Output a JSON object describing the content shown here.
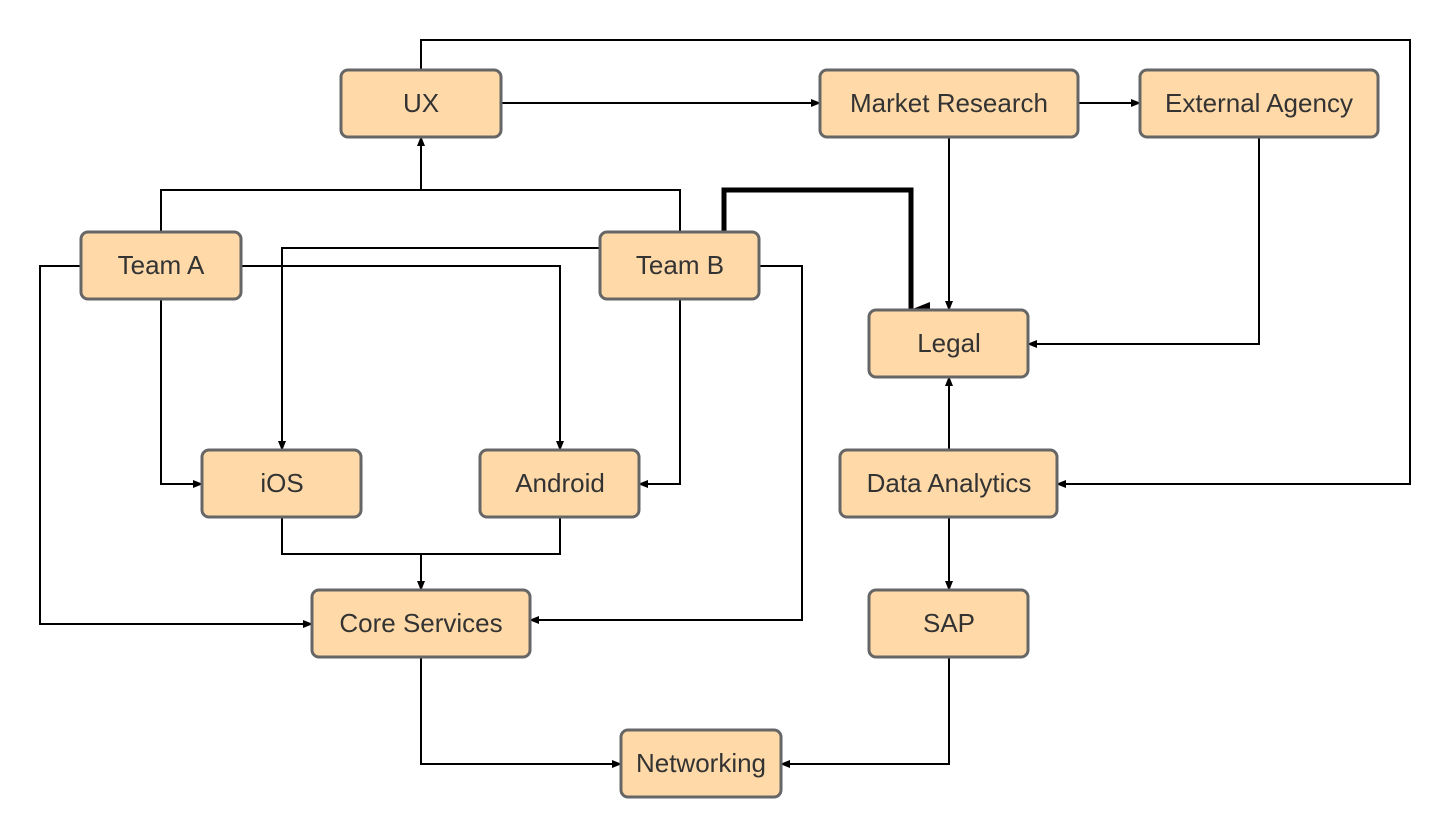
{
  "diagram": {
    "colors": {
      "node_fill": "#FFDAA8",
      "node_border": "#666666",
      "text": "#333333",
      "edge": "#000000"
    },
    "nodes": {
      "ux": "UX",
      "market_research": "Market Research",
      "external_agency": "External Agency",
      "team_a": "Team A",
      "team_b": "Team B",
      "legal": "Legal",
      "ios": "iOS",
      "android": "Android",
      "data_analytics": "Data Analytics",
      "core_services": "Core Services",
      "sap": "SAP",
      "networking": "Networking"
    },
    "edges": [
      {
        "from": "UX",
        "to": "Market Research"
      },
      {
        "from": "Market Research",
        "to": "External Agency"
      },
      {
        "from": "UX",
        "to": "Data Analytics"
      },
      {
        "from": "Team A",
        "to": "UX"
      },
      {
        "from": "Team B",
        "to": "UX"
      },
      {
        "from": "Team B",
        "to": "Legal",
        "emphasis": "thick"
      },
      {
        "from": "Market Research",
        "to": "Legal"
      },
      {
        "from": "External Agency",
        "to": "Legal"
      },
      {
        "from": "Team A",
        "to": "iOS"
      },
      {
        "from": "Team A",
        "to": "Android"
      },
      {
        "from": "Team B",
        "to": "iOS"
      },
      {
        "from": "Team B",
        "to": "Android"
      },
      {
        "from": "Team A",
        "to": "Core Services"
      },
      {
        "from": "Team B",
        "to": "Core Services"
      },
      {
        "from": "iOS",
        "to": "Core Services"
      },
      {
        "from": "Android",
        "to": "Core Services"
      },
      {
        "from": "Data Analytics",
        "to": "Legal"
      },
      {
        "from": "Data Analytics",
        "to": "SAP"
      },
      {
        "from": "Core Services",
        "to": "Networking"
      },
      {
        "from": "SAP",
        "to": "Networking"
      }
    ]
  }
}
